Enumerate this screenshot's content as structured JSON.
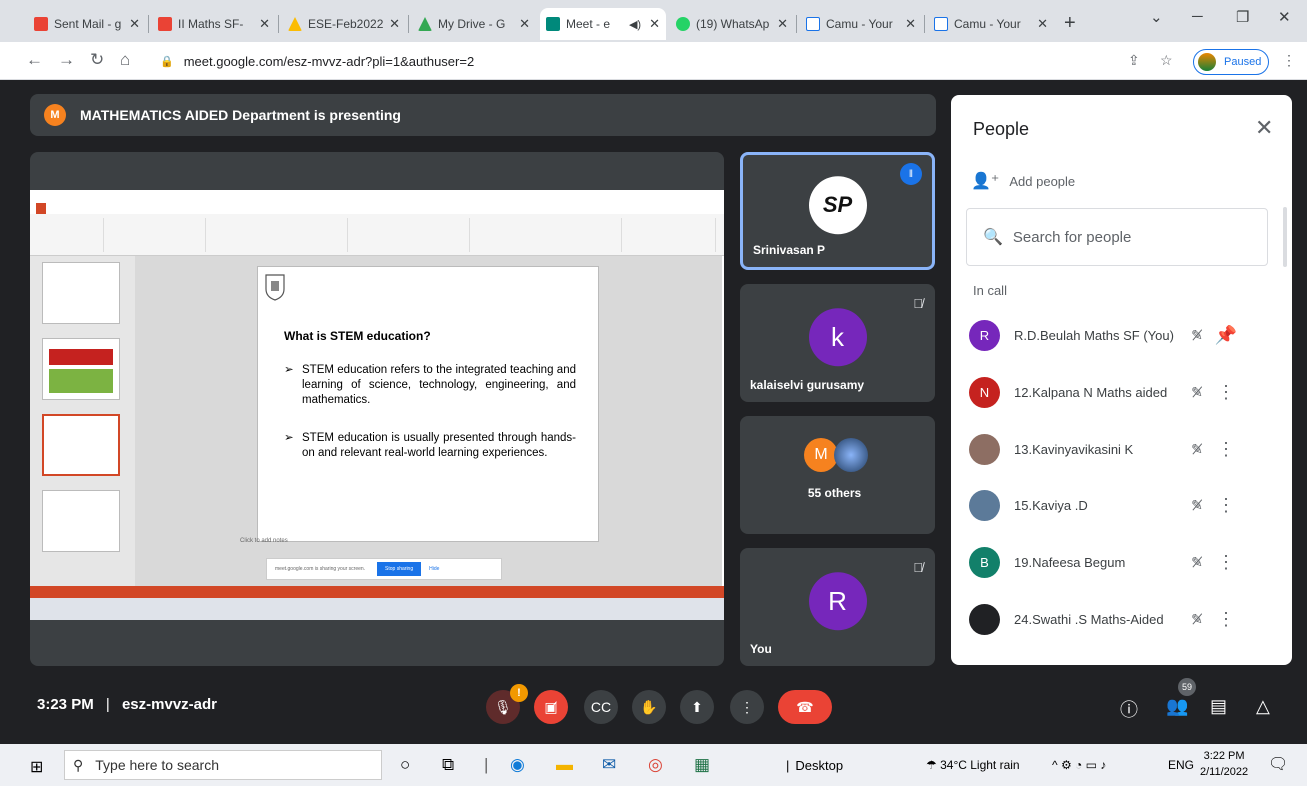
{
  "browser": {
    "tabs": [
      {
        "title": "Sent Mail - g",
        "color": "#ea4335"
      },
      {
        "title": "II Maths SF-",
        "color": "#ea4335"
      },
      {
        "title": "ESE-Feb2022",
        "color": "#fbbc04"
      },
      {
        "title": "My Drive - G",
        "color": "#34a853"
      },
      {
        "title": "Meet - e",
        "color": "#00897b"
      },
      {
        "title": "(19) WhatsAp",
        "color": "#25d366"
      },
      {
        "title": "Camu - Your",
        "color": "#1a73e8"
      },
      {
        "title": "Camu - Your",
        "color": "#1a73e8"
      }
    ],
    "new_tab": "+",
    "url": "meet.google.com/esz-mvvz-adr?pli=1&authuser=2",
    "profile_status": "Paused"
  },
  "meet": {
    "banner": {
      "avatar_letter": "M",
      "text": "MATHEMATICS AIDED Department is presenting"
    },
    "slide": {
      "heading": "What is STEM education?",
      "bullets": [
        "STEM education refers to the integrated teaching and learning of science, technology, engineering, and mathematics.",
        "STEM education is usually presented through hands-on and relevant real-world learning experiences."
      ],
      "notes": "Click to add notes",
      "share_notice": "meet.google.com is sharing your screen.",
      "stop_sharing": "Stop sharing",
      "hide": "Hide"
    },
    "tiles": [
      {
        "name": "Srinivasan P",
        "avatar": "SP"
      },
      {
        "name": "kalaiselvi gurusamy",
        "avatar": "k",
        "color": "#7627bb"
      },
      {
        "name": "55 others",
        "avatar": "M",
        "color": "#f6821f"
      },
      {
        "name": "You",
        "avatar": "R",
        "color": "#7627bb"
      }
    ],
    "people": {
      "title": "People",
      "add_people": "Add people",
      "search_placeholder": "Search for people",
      "section": "In call",
      "participants": [
        {
          "letter": "R",
          "name": "R.D.Beulah Maths SF (You)",
          "color": "#7627bb"
        },
        {
          "letter": "N",
          "name": "12.Kalpana N Maths aided",
          "color": "#c5221f"
        },
        {
          "letter": "",
          "name": "13.Kavinyavikasini K",
          "color": "#8d6e63"
        },
        {
          "letter": "",
          "name": "15.Kaviya .D",
          "color": "#5c7a99"
        },
        {
          "letter": "B",
          "name": "19.Nafeesa Begum",
          "color": "#12806a"
        },
        {
          "letter": "",
          "name": "24.Swathi .S Maths-Aided",
          "color": "#202124"
        }
      ]
    },
    "bottom": {
      "time": "3:23 PM",
      "separator": "|",
      "code": "esz-mvvz-adr",
      "mic_badge": "!",
      "participant_count": "59"
    }
  },
  "taskbar": {
    "search_placeholder": "Type here to search",
    "desktop": "Desktop",
    "weather": "34°C  Light rain",
    "lang": "ENG",
    "time": "3:22 PM",
    "date": "2/11/2022"
  }
}
